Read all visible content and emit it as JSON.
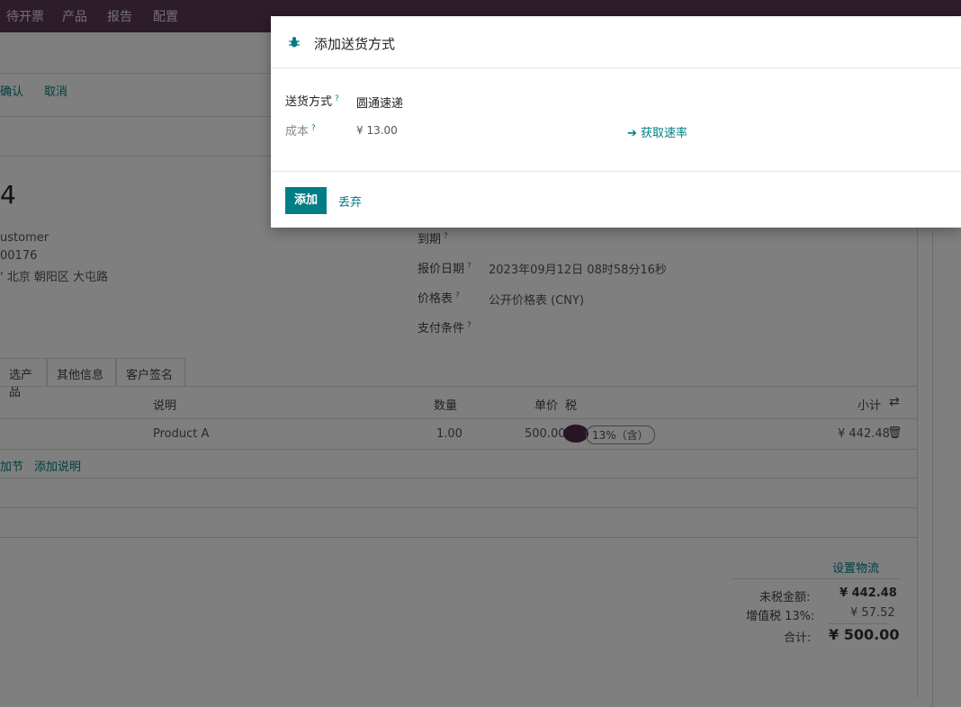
{
  "navbar": {
    "menu": [
      "待开票",
      "产品",
      "报告",
      "配置"
    ]
  },
  "page": {
    "actions": {
      "confirm": "确认",
      "cancel": "取消"
    },
    "record_number": "4",
    "customer": {
      "name": "ustomer",
      "phone": "00176",
      "address": "' 北京 朝阳区 大屯路"
    },
    "fields": {
      "expiration_label": "到期",
      "quote_date_label": "报价日期",
      "quote_date_value": "2023年09月12日 08时58分16秒",
      "pricelist_label": "价格表",
      "pricelist_value": "公开价格表 (CNY)",
      "payment_terms_label": "支付条件"
    },
    "tabs": [
      "选产品",
      "其他信息",
      "客户签名"
    ],
    "table": {
      "headers": {
        "description": "说明",
        "quantity": "数量",
        "unit_price": "单价",
        "tax": "税",
        "subtotal": "小计"
      },
      "rows": [
        {
          "description": "Product A",
          "quantity": "1.00",
          "unit_price": "500.00",
          "tax": "13%（含）",
          "subtotal": "¥ 442.48"
        }
      ],
      "add_section": "加节",
      "add_note": "添加说明"
    },
    "totals": {
      "set_shipping": "设置物流",
      "untaxed_label": "未税金额:",
      "untaxed_value": "¥ 442.48",
      "vat_label": "增值税 13%:",
      "vat_value": "¥ 57.52",
      "total_label": "合计:",
      "total_value": "¥ 500.00"
    }
  },
  "modal": {
    "title": "添加送货方式",
    "carrier_label": "送货方式",
    "carrier_value": "圆通速递",
    "cost_label": "成本",
    "cost_value": "¥ 13.00",
    "get_rate": "获取速率",
    "add_button": "添加",
    "discard_button": "丢弃"
  },
  "colors": {
    "primary": "#017e84",
    "navbar": "#5b3a54"
  },
  "icons": {
    "modal": "bug-icon",
    "rate": "arrow-right-icon",
    "delete": "trash-icon",
    "columns": "sliders-icon"
  }
}
